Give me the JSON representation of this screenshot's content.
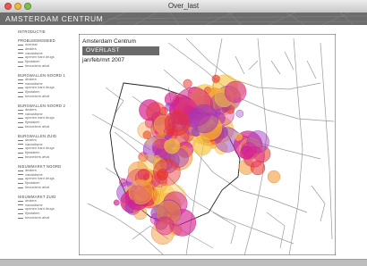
{
  "window": {
    "title": "Over_last"
  },
  "header": {
    "title": "AMSTERDAM CENTRUM"
  },
  "sidebar": {
    "sections": [
      {
        "title": "INTRODUCTIE",
        "options": []
      },
      {
        "title": "PROBLEEMGEBIED",
        "options": [
          "overlast",
          "dealers",
          "vandalisme",
          "openen hard drugs",
          "fijnstaken",
          "bezoekers afval"
        ]
      },
      {
        "title": "BURGWALLEN NOORD 1",
        "options": [
          "dealers",
          "vandalisme",
          "openen hard drugs",
          "fijnstaken",
          "bezoekers afval"
        ]
      },
      {
        "title": "BURGWALLEN NOORD 2",
        "options": [
          "dealers",
          "vandalisme",
          "openen hard drugs",
          "fijnstaken",
          "bezoekers afval"
        ]
      },
      {
        "title": "BURGWALLEN ZUID",
        "options": [
          "dealers",
          "vandalisme",
          "openen hard drugs",
          "fijnstaken",
          "bezoekers afval"
        ]
      },
      {
        "title": "NIEUWMARKT NOORD",
        "options": [
          "dealers",
          "vandalisme",
          "openen hard drugs",
          "fijnstaken",
          "bezoekers afval"
        ]
      },
      {
        "title": "NIEUWMARKT ZUID",
        "options": [
          "dealers",
          "vandalisme",
          "openen hard drugs",
          "fijnstaken",
          "bezoekers afval"
        ]
      }
    ]
  },
  "map": {
    "title": "Amsterdam Centrum",
    "layer": "OVERLAST",
    "period": "jan/feb/mrt 2007"
  },
  "colors": {
    "accent_magenta": "#d4208f",
    "accent_red": "#e8322a",
    "accent_orange": "#f2912c",
    "accent_yellow": "#f4c23a",
    "accent_purple": "#9b3bbf"
  }
}
